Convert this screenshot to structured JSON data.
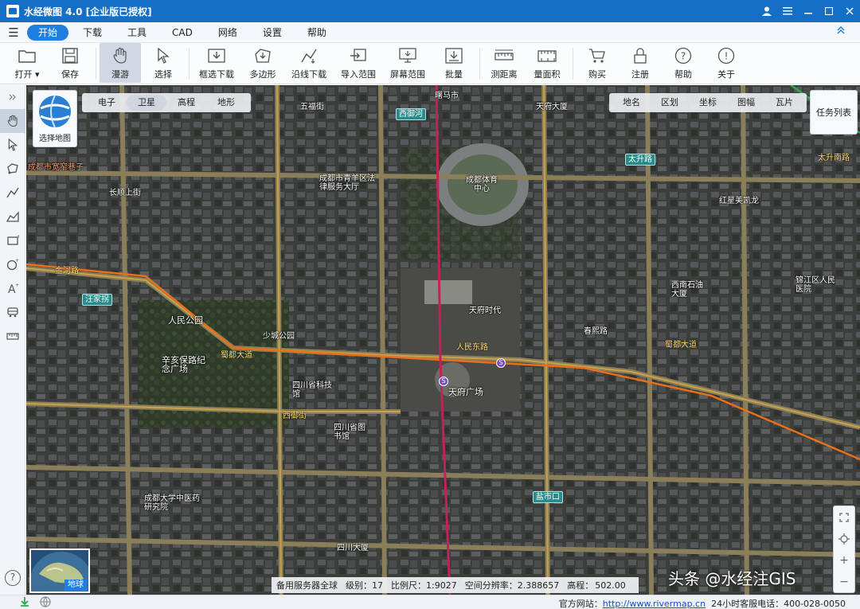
{
  "window": {
    "title": "水经微图 4.0 [企业版已授权]"
  },
  "menu": {
    "items": [
      "开始",
      "下载",
      "工具",
      "CAD",
      "网络",
      "设置",
      "帮助"
    ],
    "active_index": 0
  },
  "toolbar": {
    "open": "打开 ▾",
    "save": "保存",
    "pan": "漫游",
    "select": "选择",
    "box_download": "框选下载",
    "polygon": "多边形",
    "line_download": "沿线下载",
    "import_extent": "导入范围",
    "screen_extent": "屏幕范围",
    "batch": "批量",
    "measure_distance": "测距离",
    "measure_area": "量面积",
    "purchase": "购买",
    "register": "注册",
    "help": "帮助",
    "about": "关于"
  },
  "map_switcher": {
    "label": "选择地图"
  },
  "map_types": [
    "电子",
    "卫星",
    "高程",
    "地形"
  ],
  "map_type_active": 1,
  "layer_tabs": [
    "地名",
    "区划",
    "坐标",
    "图幅",
    "瓦片"
  ],
  "task_list": "任务列表",
  "overview_label": "地球",
  "watermark": "头条 @水经注GIS",
  "map_status": {
    "server": "备用服务器全球",
    "level": "级别：17",
    "scale": "比例尺：1:9027",
    "resolution": "空间分辨率：2.388657",
    "elevation_label": "高程：",
    "elevation_value": "502.00"
  },
  "statusbar": {
    "website_label": "官方网站：",
    "website_url": "http://www.rivermap.cn",
    "hotline": "24小时客服电话：400-028-0050"
  },
  "map_labels": {
    "roads": [
      {
        "text": "西御河"
      },
      {
        "text": "太升路"
      },
      {
        "text": "金河路"
      },
      {
        "text": "人民东路"
      },
      {
        "text": "蜀都大道"
      },
      {
        "text": "西御街"
      },
      {
        "text": "盐市口"
      },
      {
        "text": "汪家拐"
      },
      {
        "text": "太升南路"
      }
    ],
    "pois": [
      {
        "text": "曙马市"
      },
      {
        "text": "五福街"
      },
      {
        "text": "成都市青羊区法律服务大厅"
      },
      {
        "text": "成都体育中心"
      },
      {
        "text": "人民公园"
      },
      {
        "text": "辛亥保路纪念广场"
      },
      {
        "text": "天府广场"
      },
      {
        "text": "四川省图书馆"
      },
      {
        "text": "天府时代"
      },
      {
        "text": "西南石油大厦"
      },
      {
        "text": "成都大学中医药研究院"
      },
      {
        "text": "四川大厦"
      },
      {
        "text": "少城公园"
      },
      {
        "text": "四川省科技馆"
      },
      {
        "text": "锦江区人民医院"
      },
      {
        "text": "春熙路"
      },
      {
        "text": "成都市宽窄巷子"
      },
      {
        "text": "天府大厦"
      },
      {
        "text": "红星美凯龙"
      },
      {
        "text": "长顺上街"
      }
    ]
  },
  "colors": {
    "title_bg": "#1570c5",
    "menu_active": "#1f7fe0",
    "metro_line": "#c0235a"
  }
}
